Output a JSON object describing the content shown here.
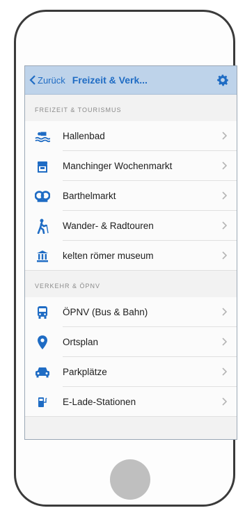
{
  "nav": {
    "back_label": "Zurück",
    "title": "Freizeit & Verk...",
    "settings_icon": "gear-icon"
  },
  "sections": [
    {
      "header": "FREIZEIT & TOURISMUS",
      "items": [
        {
          "label": "Hallenbad",
          "icon": "swimming-icon"
        },
        {
          "label": "Manchinger Wochenmarkt",
          "icon": "market-icon"
        },
        {
          "label": "Barthelmarkt",
          "icon": "ferris-wheel-icon"
        },
        {
          "label": "Wander- & Radtouren",
          "icon": "hiking-icon"
        },
        {
          "label": "kelten römer museum",
          "icon": "museum-icon"
        }
      ]
    },
    {
      "header": "VERKEHR & ÖPNV",
      "items": [
        {
          "label": "ÖPNV (Bus & Bahn)",
          "icon": "bus-icon"
        },
        {
          "label": "Ortsplan",
          "icon": "map-pin-icon"
        },
        {
          "label": "Parkplätze",
          "icon": "car-icon"
        },
        {
          "label": "E-Lade-Stationen",
          "icon": "charging-station-icon"
        }
      ]
    }
  ],
  "colors": {
    "accent": "#1f6cc4",
    "navbar": "#bed3ea"
  }
}
